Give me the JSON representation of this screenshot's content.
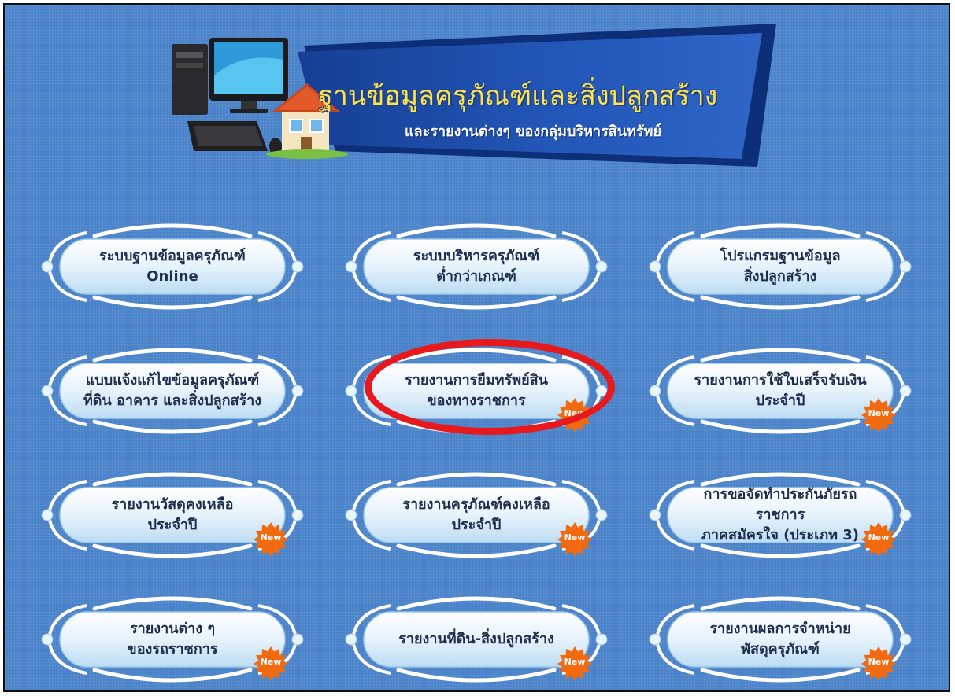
{
  "header": {
    "title": "ฐานข้อมูลครุภัณฑ์และสิ่งปลูกสร้าง",
    "subtitle": "และรายงานต่างๆ ของกลุ่มบริหารสินทรัพย์"
  },
  "badge_label": "New",
  "colors": {
    "background": "#4a83c9",
    "banner": "#1f4ea5",
    "title": "#ffe34a",
    "tile_fill": "#e3f1fb",
    "badge": "#f26a10",
    "highlight": "#e8191d"
  },
  "tiles": [
    {
      "line1": "ระบบฐานข้อมูลครุภัณฑ์",
      "line2": "Online",
      "is_new": false
    },
    {
      "line1": "ระบบบริหารครุภัณฑ์",
      "line2": "ต่ำกว่าเกณฑ์",
      "is_new": false
    },
    {
      "line1": "โปรแกรมฐานข้อมูล",
      "line2": "สิ่งปลูกสร้าง",
      "is_new": false
    },
    {
      "line1": "แบบแจ้งแก้ไขข้อมูลครุภัณฑ์",
      "line2": "ที่ดิน อาคาร และสิ่งปลูกสร้าง",
      "is_new": false
    },
    {
      "line1": "รายงานการยืมทรัพย์สิน",
      "line2": "ของทางราชการ",
      "is_new": true
    },
    {
      "line1": "รายงานการใช้ใบเสร็จรับเงิน",
      "line2": "ประจำปี",
      "is_new": true
    },
    {
      "line1": "รายงานวัสดุคงเหลือ",
      "line2": "ประจำปี",
      "is_new": true
    },
    {
      "line1": "รายงานครุภัณฑ์คงเหลือ",
      "line2": "ประจำปี",
      "is_new": true
    },
    {
      "line1": "การขอจัดทำประกันภัยรถราชการ",
      "line2": "ภาคสมัครใจ (ประเภท 3)",
      "is_new": true
    },
    {
      "line1": "รายงานต่าง ๆ",
      "line2": "ของรถราชการ",
      "is_new": true
    },
    {
      "line1": "รายงานที่ดิน-สิ่งปลูกสร้าง",
      "line2": "",
      "is_new": true
    },
    {
      "line1": "รายงานผลการจำหน่าย",
      "line2": "พัสดุครุภัณฑ์",
      "is_new": true
    }
  ]
}
